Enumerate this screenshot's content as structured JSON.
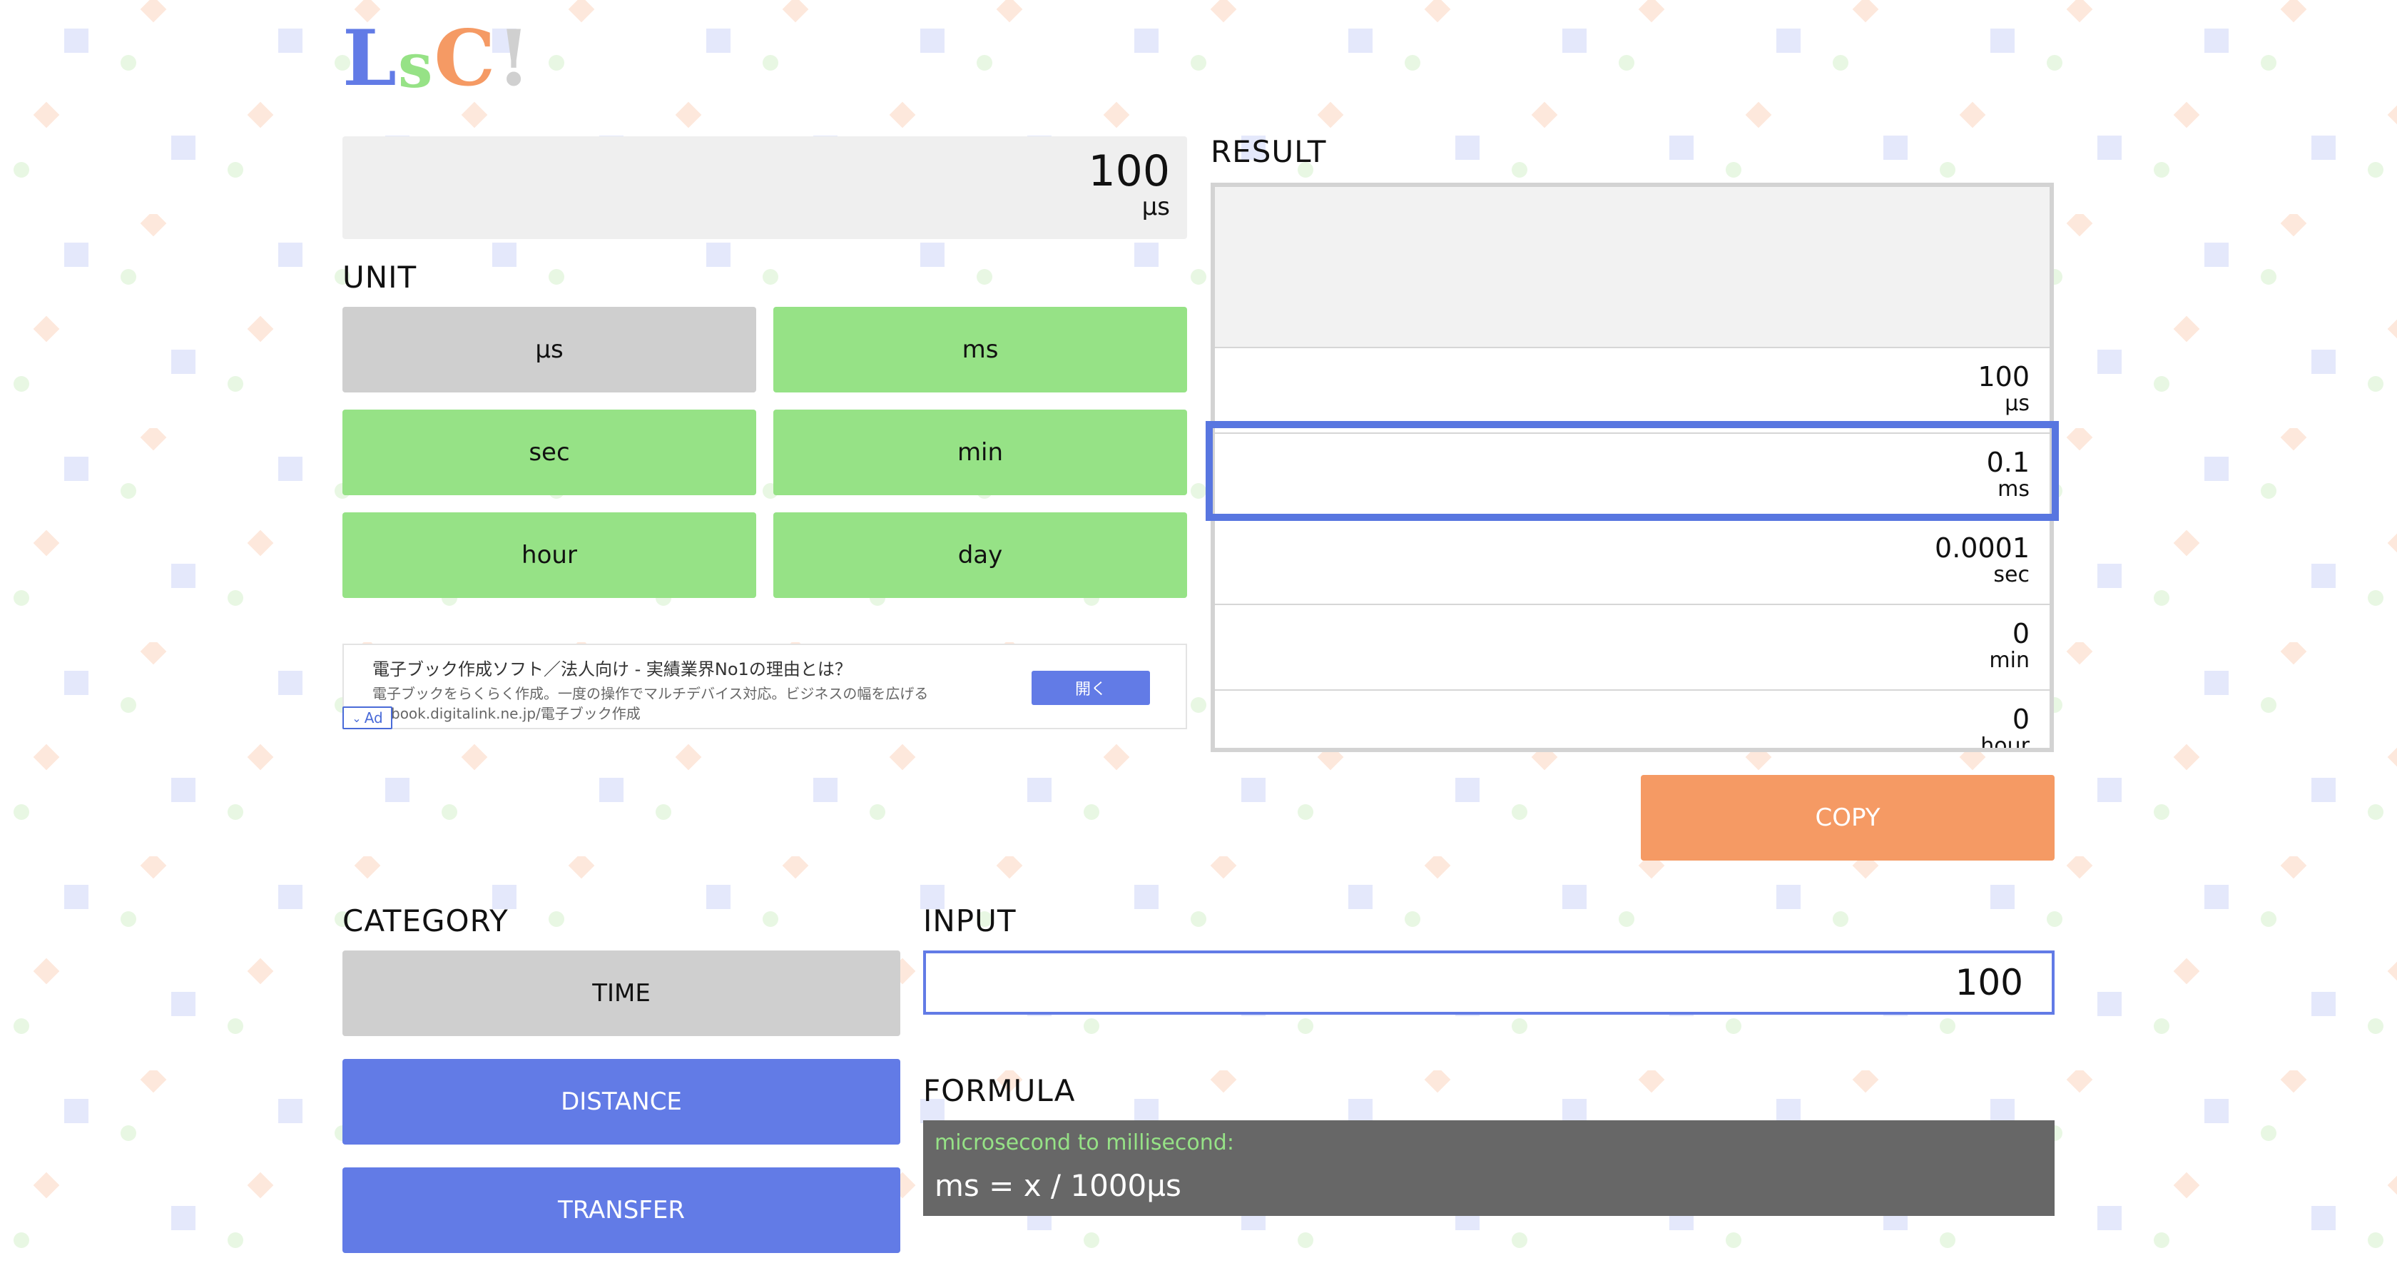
{
  "logo": {
    "text": [
      "L",
      "s",
      "C",
      "!"
    ],
    "colors": [
      "#627be6",
      "#96e286",
      "#f59a64",
      "#d0d0d0"
    ]
  },
  "display": {
    "value": "100",
    "unit": "µs"
  },
  "unit_section": {
    "label": "UNIT",
    "buttons": [
      {
        "label": "µs",
        "state": "selected"
      },
      {
        "label": "ms",
        "state": "normal"
      },
      {
        "label": "sec",
        "state": "normal"
      },
      {
        "label": "min",
        "state": "normal"
      },
      {
        "label": "hour",
        "state": "normal"
      },
      {
        "label": "day",
        "state": "normal"
      }
    ]
  },
  "ad": {
    "headline": "電子ブック作成ソフト／法人向け - 実績業界No1の理由とは？",
    "description": "電子ブックをらくらく作成。一度の操作でマルチデバイス対応。ビジネスの幅を広げる",
    "url": "book.digitalink.ne.jp/電子ブック作成",
    "button": "開く",
    "badge": "Ad"
  },
  "result": {
    "label": "RESULT",
    "rows": [
      {
        "value": "100",
        "unit": "µs"
      },
      {
        "value": "0.1",
        "unit": "ms"
      },
      {
        "value": "0.0001",
        "unit": "sec"
      },
      {
        "value": "0",
        "unit": "min"
      },
      {
        "value": "0",
        "unit": "hour"
      }
    ],
    "selected_index": 1
  },
  "copy_button": "COPY",
  "category": {
    "label": "CATEGORY",
    "buttons": [
      {
        "label": "TIME",
        "state": "selected"
      },
      {
        "label": "DISTANCE",
        "state": "normal"
      },
      {
        "label": "TRANSFER",
        "state": "normal"
      }
    ]
  },
  "input": {
    "label": "INPUT",
    "value": "100"
  },
  "formula": {
    "label": "FORMULA",
    "title": "microsecond to millisecond:",
    "expression": "ms = x / 1000µs"
  },
  "colors": {
    "accent_blue": "#627be6",
    "green": "#96e286",
    "orange": "#f59a64",
    "gray": "#cfcfcf"
  }
}
